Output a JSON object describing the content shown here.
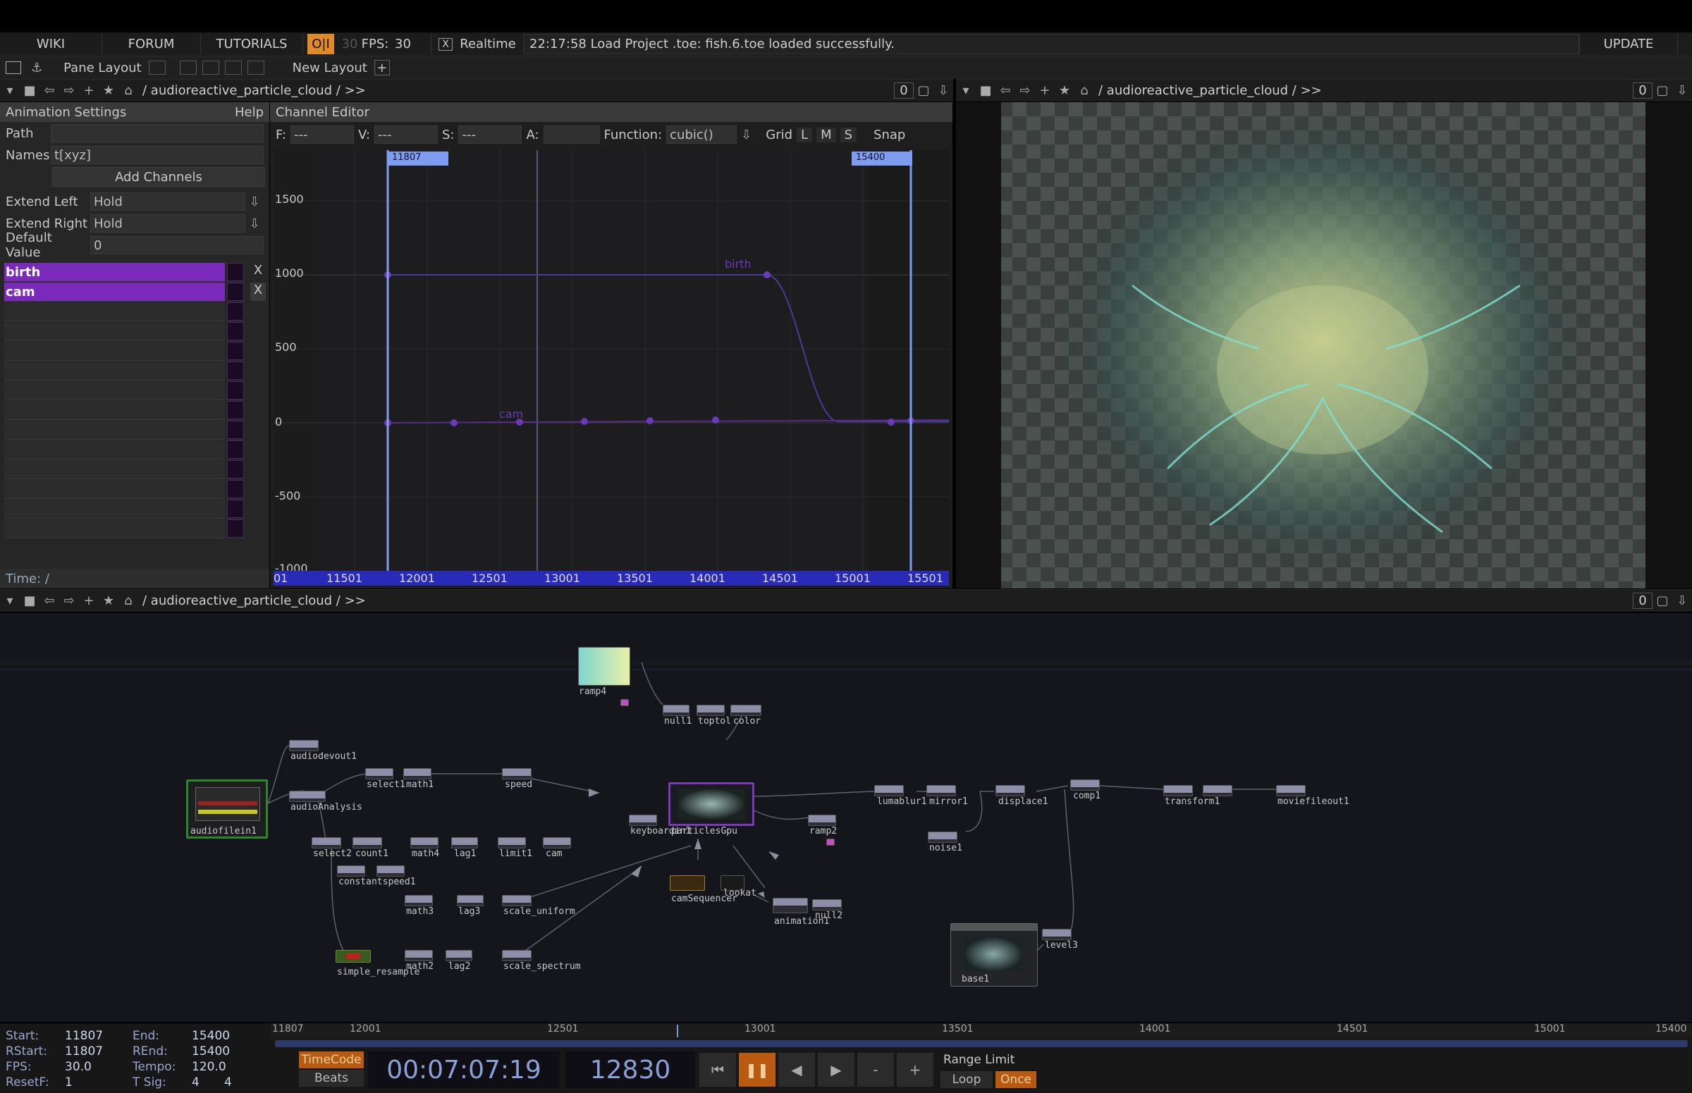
{
  "topbar": {
    "wiki": "WIKI",
    "forum": "FORUM",
    "tutorials": "TUTORIALS",
    "oi": "O|I",
    "fps_greyed": "30",
    "fps_label": "FPS:",
    "fps_value": "30",
    "realtime_check": "X",
    "realtime": "Realtime",
    "status": "22:17:58 Load Project .toe: fish.6.toe loaded successfully.",
    "update": "UPDATE"
  },
  "layoutbar": {
    "pane_layout": "Pane Layout",
    "new_layout": "New Layout"
  },
  "pane_top_left": {
    "path": "/ audioreactive_particle_cloud / >>",
    "zero": "0"
  },
  "pane_top_right": {
    "path": "/ audioreactive_particle_cloud / >>",
    "zero": "0"
  },
  "pane_network": {
    "path": "/ audioreactive_particle_cloud / >>",
    "zero": "0"
  },
  "animation": {
    "title": "Animation Settings",
    "help": "Help",
    "path_label": "Path",
    "path_value": "",
    "names_label": "Names",
    "names_value": "t[xyz]",
    "add_channels": "Add Channels",
    "extend_left_label": "Extend Left",
    "extend_left_value": "Hold",
    "extend_right_label": "Extend Right",
    "extend_right_value": "Hold",
    "default_label": "Default Value",
    "default_value": "0",
    "channels": [
      {
        "name": "birth",
        "x": "X"
      },
      {
        "name": "cam",
        "x": "X"
      }
    ],
    "time_label": "Time: /"
  },
  "channel_editor": {
    "title": "Channel Editor",
    "f_label": "F:",
    "f_value": "---",
    "v_label": "V:",
    "v_value": "---",
    "s_label": "S:",
    "s_value": "---",
    "a_label": "A:",
    "a_value": "",
    "function_label": "Function:",
    "function_value": "cubic()",
    "grid": "Grid",
    "l": "L",
    "m": "M",
    "s": "S",
    "snap": "Snap",
    "range_start_tag": "11807",
    "range_end_tag": "15400",
    "birth_label": "birth",
    "cam_label": "cam",
    "y_ticks": [
      "1500",
      "1000",
      "500",
      "0",
      "-500",
      "-1000"
    ],
    "x_ticks": [
      "01",
      "11501",
      "12001",
      "12501",
      "13001",
      "13501",
      "14001",
      "14501",
      "15001",
      "15501"
    ]
  },
  "nodes": [
    {
      "id": "ramp4",
      "label": "ramp4"
    },
    {
      "id": "null1",
      "label": "null1"
    },
    {
      "id": "toptol",
      "label": "toptol"
    },
    {
      "id": "color",
      "label": "color"
    },
    {
      "id": "audiodevout1",
      "label": "audiodevout1"
    },
    {
      "id": "audiofilein1",
      "label": "audiofilein1"
    },
    {
      "id": "audioAnalysis",
      "label": "audioAnalysis"
    },
    {
      "id": "select1",
      "label": "select1"
    },
    {
      "id": "math1",
      "label": "math1"
    },
    {
      "id": "speed",
      "label": "speed"
    },
    {
      "id": "select2",
      "label": "select2"
    },
    {
      "id": "count1",
      "label": "count1"
    },
    {
      "id": "math4",
      "label": "math4"
    },
    {
      "id": "lag1",
      "label": "lag1"
    },
    {
      "id": "limit1",
      "label": "limit1"
    },
    {
      "id": "cam",
      "label": "cam"
    },
    {
      "id": "constantspeed1",
      "label": "constantspeed1"
    },
    {
      "id": "math3",
      "label": "math3"
    },
    {
      "id": "lag3",
      "label": "lag3"
    },
    {
      "id": "scale_uniform",
      "label": "scale_uniform"
    },
    {
      "id": "simple_resample",
      "label": "simple_resample"
    },
    {
      "id": "math2",
      "label": "math2"
    },
    {
      "id": "lag2",
      "label": "lag2"
    },
    {
      "id": "scale_spectrum",
      "label": "scale_spectrum"
    },
    {
      "id": "keyboardin1",
      "label": "keyboardin1"
    },
    {
      "id": "particlesGpu",
      "label": "particlesGpu"
    },
    {
      "id": "ramp2",
      "label": "ramp2"
    },
    {
      "id": "camSequencer",
      "label": "camSequencer"
    },
    {
      "id": "lookat",
      "label": "lookat"
    },
    {
      "id": "animation1",
      "label": "animation1"
    },
    {
      "id": "null2",
      "label": "null2"
    },
    {
      "id": "lumablur1",
      "label": "lumablur1"
    },
    {
      "id": "mirror1",
      "label": "mirror1"
    },
    {
      "id": "noise1",
      "label": "noise1"
    },
    {
      "id": "displace1",
      "label": "displace1"
    },
    {
      "id": "comp1",
      "label": "comp1"
    },
    {
      "id": "transform1",
      "label": "transform1"
    },
    {
      "id": "moviefileout1",
      "label": "moviefileout1"
    },
    {
      "id": "level3",
      "label": "level3"
    },
    {
      "id": "base1",
      "label": "base1"
    }
  ],
  "bottom": {
    "start_label": "Start:",
    "start": "11807",
    "end_label": "End:",
    "end": "15400",
    "rstart_label": "RStart:",
    "rstart": "11807",
    "rend_label": "REnd:",
    "rend": "15400",
    "fps_label": "FPS:",
    "fps": "30.0",
    "tempo_label": "Tempo:",
    "tempo": "120.0",
    "resetf_label": "ResetF:",
    "resetf": "1",
    "tsig_label": "T Sig:",
    "tsig_a": "4",
    "tsig_b": "4",
    "timecode": "TimeCode",
    "beats": "Beats",
    "time": "00:07:07:19",
    "frame": "12830",
    "range_limit": "Range Limit",
    "loop": "Loop",
    "once": "Once",
    "ruler": [
      "11807",
      "12001",
      "12501",
      "13001",
      "13501",
      "14001",
      "14501",
      "15001",
      "15400"
    ]
  }
}
